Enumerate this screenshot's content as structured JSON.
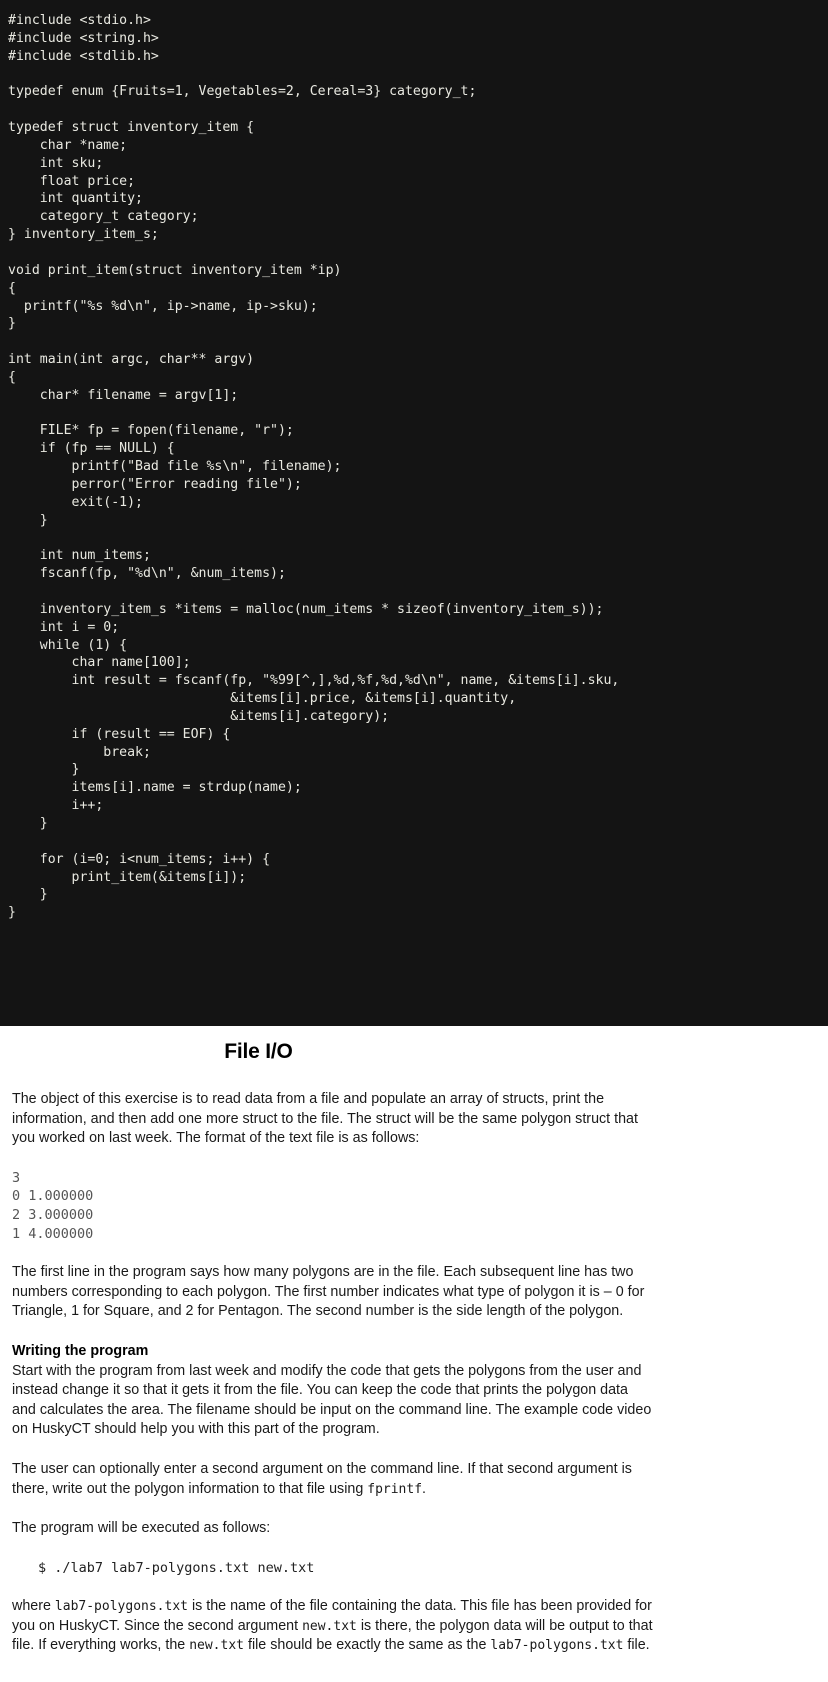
{
  "code_pane": {
    "language": "c",
    "background_color": "#141414",
    "text_color": "#e9e9e1",
    "source": "#include <stdio.h>\n#include <string.h>\n#include <stdlib.h>\n\ntypedef enum {Fruits=1, Vegetables=2, Cereal=3} category_t;\n\ntypedef struct inventory_item {\n    char *name;\n    int sku;\n    float price;\n    int quantity;\n    category_t category;\n} inventory_item_s;\n\nvoid print_item(struct inventory_item *ip)\n{\n  printf(\"%s %d\\n\", ip->name, ip->sku);\n}\n\nint main(int argc, char** argv)\n{\n    char* filename = argv[1];\n\n    FILE* fp = fopen(filename, \"r\");\n    if (fp == NULL) {\n        printf(\"Bad file %s\\n\", filename);\n        perror(\"Error reading file\");\n        exit(-1);\n    }\n\n    int num_items;\n    fscanf(fp, \"%d\\n\", &num_items);\n\n    inventory_item_s *items = malloc(num_items * sizeof(inventory_item_s));\n    int i = 0;\n    while (1) {\n        char name[100];\n        int result = fscanf(fp, \"%99[^,],%d,%f,%d,%d\\n\", name, &items[i].sku,\n                            &items[i].price, &items[i].quantity,\n                            &items[i].category);\n        if (result == EOF) {\n            break;\n        }\n        items[i].name = strdup(name);\n        i++;\n    }\n\n    for (i=0; i<num_items; i++) {\n        print_item(&items[i]);\n    }\n}"
  },
  "document": {
    "title": "File I/O",
    "paragraph_1": "The object of this exercise is to read data from a file and populate an array of structs, print the information, and then add one more struct to the file.  The struct will be the same polygon struct that you worked on last week.  The format of the text file is as follows:",
    "file_sample": "3\n0 1.000000\n2 3.000000\n1 4.000000",
    "paragraph_2": "The first line in the program says how many polygons are in the file.  Each subsequent line has two numbers corresponding to each polygon.  The first number indicates what type of polygon it is – 0 for Triangle, 1 for Square, and 2 for Pentagon.  The second number is the side length of the polygon.",
    "subheading": "Writing the program",
    "paragraph_3": "Start with the program from last week and modify the code that gets the polygons from the user and instead change it so that it gets it from the file.  You can keep the code that prints the polygon data and calculates the area.  The filename should be input on the command line.  The example code video on HuskyCT should help you with this part of the program.",
    "paragraph_4_pre": "The user can optionally enter a second argument on the command line.  If that second argument is there, write out the polygon information to that file using ",
    "paragraph_4_code": "fprintf",
    "paragraph_4_post": ".",
    "paragraph_5": "The program will be executed as follows:",
    "command_line": "$ ./lab7 lab7-polygons.txt new.txt",
    "paragraph_6_a": "where ",
    "paragraph_6_code1": "lab7-polygons.txt",
    "paragraph_6_b": " is the name of the file containing the data.  This file has been provided for you on HuskyCT.  Since the second argument ",
    "paragraph_6_code2": "new.txt",
    "paragraph_6_c": " is there, the polygon data will be output to that file.  If everything works, the ",
    "paragraph_6_code3": "new.txt",
    "paragraph_6_d": " file should be exactly the same as the ",
    "paragraph_6_code4": "lab7-polygons.txt",
    "paragraph_6_e": " file."
  }
}
